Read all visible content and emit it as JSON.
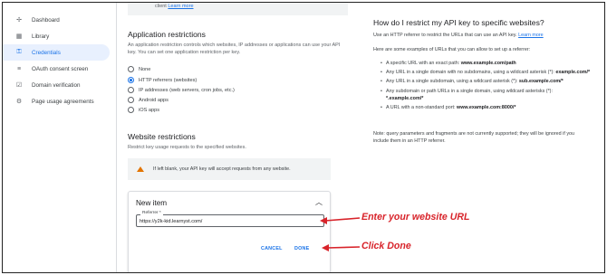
{
  "sidebar": {
    "items": [
      {
        "icon": "dashboard-icon",
        "glyph": "✢",
        "label": "Dashboard",
        "active": false
      },
      {
        "icon": "library-icon",
        "glyph": "▦",
        "label": "Library",
        "active": false
      },
      {
        "icon": "key-icon",
        "glyph": "⚿",
        "label": "Credentials",
        "active": true
      },
      {
        "icon": "consent-icon",
        "glyph": "≡",
        "label": "OAuth consent screen",
        "active": false
      },
      {
        "icon": "domain-icon",
        "glyph": "☑",
        "label": "Domain verification",
        "active": false
      },
      {
        "icon": "agreements-icon",
        "glyph": "⚙",
        "label": "Page usage agreements",
        "active": false
      }
    ]
  },
  "main": {
    "top_note": {
      "text": "client ",
      "link": "Learn more"
    },
    "app_restrictions": {
      "title": "Application restrictions",
      "description": "An application restriction controls which websites, IP addresses or applications can use your API key. You can set one application restriction per key.",
      "options": [
        {
          "label": "None",
          "checked": false
        },
        {
          "label": "HTTP referrers (websites)",
          "checked": true
        },
        {
          "label": "IP addresses (web servers, cron jobs, etc.)",
          "checked": false
        },
        {
          "label": "Android apps",
          "checked": false
        },
        {
          "label": "iOS apps",
          "checked": false
        }
      ]
    },
    "website_restrictions": {
      "title": "Website restrictions",
      "description": "Restrict key usage requests to the specified websites.",
      "warning": "If left blank, your API key will accept requests from any website."
    },
    "new_item": {
      "title": "New item",
      "field_label": "Referrer *",
      "field_value": "https://y2k-kid.learnyst.com/",
      "cancel_label": "CANCEL",
      "done_label": "DONE"
    }
  },
  "annotations": {
    "enter_url": "Enter your website URL",
    "click_done": "Click Done",
    "color": "#d8232a"
  },
  "help": {
    "title": "How do I restrict my API key to specific websites?",
    "intro": "Use an HTTP referrer to restrict the URLs that can use an API key.",
    "intro_link": "Learn more",
    "examples_intro": "Here are some examples of URLs that you can allow to set up a referrer:",
    "bullets": [
      {
        "text": "A specific URL with an exact path: ",
        "bold": "www.example.com/path"
      },
      {
        "text": "Any URL in a single domain with no subdomains, using a wildcard asterisk (*): ",
        "bold": "example.com/*"
      },
      {
        "text": "Any URL in a single subdomain, using a wildcard asterisk (*): ",
        "bold": "sub.example.com/*"
      },
      {
        "text": "Any subdomain or path URLs in a single domain, using wildcard asterisks (*): ",
        "bold": "*.example.com/*"
      },
      {
        "text": "A URL with a non-standard port: ",
        "bold": "www.example.com:8000/*"
      }
    ],
    "note": "Note: query parameters and fragments are not currently supported; they will be ignored if you include them in an HTTP referrer."
  }
}
